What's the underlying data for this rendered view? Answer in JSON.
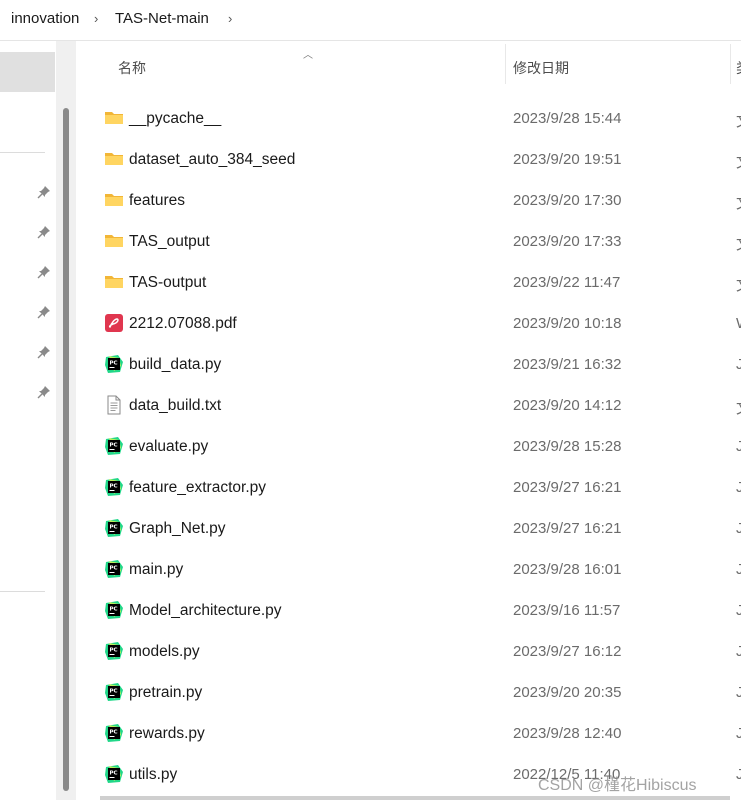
{
  "breadcrumb": {
    "items": [
      "innovation",
      "TAS-Net-main"
    ],
    "separator": "›"
  },
  "header": {
    "name_label": "名称",
    "date_label": "修改日期",
    "type_label_partial": "类"
  },
  "files": [
    {
      "name": "__pycache__",
      "date": "2023/9/28 15:44",
      "type_partial": "文",
      "icon": "folder-icon"
    },
    {
      "name": "dataset_auto_384_seed",
      "date": "2023/9/20 19:51",
      "type_partial": "文",
      "icon": "folder-icon"
    },
    {
      "name": "features",
      "date": "2023/9/20 17:30",
      "type_partial": "文",
      "icon": "folder-icon"
    },
    {
      "name": "TAS_output",
      "date": "2023/9/20 17:33",
      "type_partial": "文",
      "icon": "folder-icon"
    },
    {
      "name": "TAS-output",
      "date": "2023/9/22 11:47",
      "type_partial": "文",
      "icon": "folder-icon"
    },
    {
      "name": "2212.07088.pdf",
      "date": "2023/9/20 10:18",
      "type_partial": "W",
      "icon": "pdf-icon"
    },
    {
      "name": "build_data.py",
      "date": "2023/9/21 16:32",
      "type_partial": "J",
      "icon": "pycharm-icon"
    },
    {
      "name": "data_build.txt",
      "date": "2023/9/20 14:12",
      "type_partial": "文",
      "icon": "text-file-icon"
    },
    {
      "name": "evaluate.py",
      "date": "2023/9/28 15:28",
      "type_partial": "J",
      "icon": "pycharm-icon"
    },
    {
      "name": "feature_extractor.py",
      "date": "2023/9/27 16:21",
      "type_partial": "J",
      "icon": "pycharm-icon"
    },
    {
      "name": "Graph_Net.py",
      "date": "2023/9/27 16:21",
      "type_partial": "J",
      "icon": "pycharm-icon"
    },
    {
      "name": "main.py",
      "date": "2023/9/28 16:01",
      "type_partial": "J",
      "icon": "pycharm-icon"
    },
    {
      "name": "Model_architecture.py",
      "date": "2023/9/16 11:57",
      "type_partial": "J",
      "icon": "pycharm-icon"
    },
    {
      "name": "models.py",
      "date": "2023/9/27 16:12",
      "type_partial": "J",
      "icon": "pycharm-icon"
    },
    {
      "name": "pretrain.py",
      "date": "2023/9/20 20:35",
      "type_partial": "J",
      "icon": "pycharm-icon"
    },
    {
      "name": "rewards.py",
      "date": "2023/9/28 12:40",
      "type_partial": "J",
      "icon": "pycharm-icon"
    },
    {
      "name": "utils.py",
      "date": "2022/12/5 11:40",
      "type_partial": "J",
      "icon": "pycharm-icon"
    }
  ],
  "watermark": "CSDN @槿花Hibiscus",
  "colors": {
    "folder": "#f8c94c",
    "pdf": "#e0364f",
    "pycharm_bg": "#1fd18a",
    "selected_nav": "#e0e0e0"
  }
}
